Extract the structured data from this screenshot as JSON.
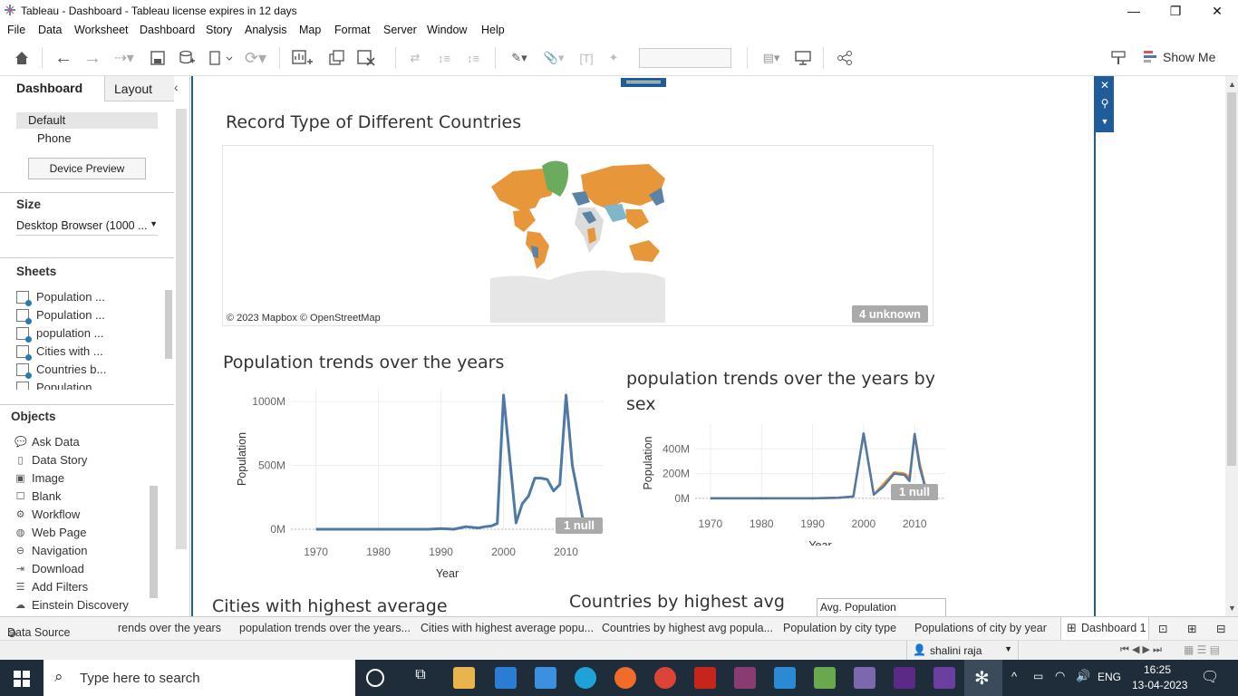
{
  "window": {
    "title": "Tableau - Dashboard - Tableau license expires in 12 days"
  },
  "menu": [
    "File",
    "Data",
    "Worksheet",
    "Dashboard",
    "Story",
    "Analysis",
    "Map",
    "Format",
    "Server",
    "Window",
    "Help"
  ],
  "toolbar": {
    "show_me": "Show Me"
  },
  "left": {
    "tab_dashboard": "Dashboard",
    "tab_layout": "Layout",
    "device_default": "Default",
    "device_phone": "Phone",
    "device_preview": "Device Preview",
    "size_title": "Size",
    "size_value": "Desktop Browser (1000 ...",
    "sheets_title": "Sheets",
    "sheets": [
      "Population ...",
      "Population ...",
      "population ...",
      "Cities with ...",
      "Countries b...",
      "Population ..."
    ],
    "objects_title": "Objects",
    "objects": [
      {
        "label": "Ask Data",
        "icon": "ask-data-icon"
      },
      {
        "label": "Data Story",
        "icon": "data-story-icon"
      },
      {
        "label": "Image",
        "icon": "image-icon"
      },
      {
        "label": "Blank",
        "icon": "blank-icon"
      },
      {
        "label": "Workflow",
        "icon": "workflow-icon"
      },
      {
        "label": "Web Page",
        "icon": "globe-icon"
      },
      {
        "label": "Navigation",
        "icon": "navigation-icon"
      },
      {
        "label": "Download",
        "icon": "download-icon"
      },
      {
        "label": "Add Filters",
        "icon": "filter-icon"
      },
      {
        "label": "Einstein Discovery",
        "icon": "einstein-icon"
      }
    ]
  },
  "dashboard": {
    "map_title": "Record Type of Different Countries",
    "map_attribution": "© 2023 Mapbox © OpenStreetMap",
    "map_unknown": "4 unknown",
    "chart1_title": "Population trends over the years",
    "chart2_title": "population trends over the years by sex",
    "chart3_title": "Cities with highest average",
    "chart4_title": "Countries by highest avg",
    "legend_title": "Avg. Population",
    "colors": {
      "series_blue": "#4e79a7",
      "series_orange": "#f28e2b",
      "map_orange": "#e8963a",
      "map_green": "#6aab5e",
      "map_blue": "#5b83a6"
    }
  },
  "chart_data": [
    {
      "type": "line",
      "title": "Population trends over the years",
      "xlabel": "Year",
      "ylabel": "Population",
      "x": [
        1970,
        1975,
        1980,
        1985,
        1988,
        1990,
        1992,
        1994,
        1996,
        1997,
        1998,
        1999,
        2000,
        2002,
        2003,
        2004,
        2005,
        2006,
        2007,
        2008,
        2009,
        2010,
        2011,
        2013
      ],
      "series": [
        {
          "values": [
            0,
            0,
            0,
            0,
            0,
            5,
            0,
            20,
            10,
            20,
            25,
            45,
            1050,
            50,
            200,
            260,
            400,
            400,
            390,
            300,
            350,
            1050,
            500,
            0
          ]
        }
      ],
      "yticks": [
        "0M",
        "500M",
        "1000M"
      ],
      "ylim": [
        0,
        1100
      ],
      "xlim": [
        1966,
        2016
      ],
      "xticks": [
        "1970",
        "1980",
        "1990",
        "2000",
        "2010"
      ],
      "null_label": "1 null"
    },
    {
      "type": "line",
      "title": "population trends over the years by sex",
      "xlabel": "Year",
      "ylabel": "Population",
      "x": [
        1970,
        1980,
        1990,
        1995,
        1998,
        2000,
        2002,
        2004,
        2006,
        2008,
        2009,
        2010,
        2011,
        2012
      ],
      "series": [
        {
          "values": [
            0,
            0,
            0,
            5,
            15,
            525,
            30,
            100,
            200,
            190,
            140,
            520,
            250,
            100
          ]
        },
        {
          "values": [
            0,
            0,
            0,
            5,
            15,
            525,
            30,
            120,
            210,
            200,
            170,
            520,
            280,
            110
          ]
        }
      ],
      "yticks": [
        "0M",
        "200M",
        "400M"
      ],
      "ylim": [
        -30,
        600
      ],
      "xlim": [
        1967,
        2016
      ],
      "xticks": [
        "1970",
        "1980",
        "1990",
        "2000",
        "2010"
      ],
      "null_label": "1 null"
    }
  ],
  "bottom_tabs": [
    "Data Source",
    "rends over the years",
    "population trends over the years...",
    "Cities with highest average popu...",
    "Countries by highest avg popula...",
    "Population by city type",
    "Populations of city by year",
    "Dashboard 1"
  ],
  "status": {
    "user": "shalini raja"
  },
  "taskbar": {
    "search_placeholder": "Type here to search",
    "lang": "ENG",
    "time": "16:25",
    "date": "13-04-2023"
  }
}
